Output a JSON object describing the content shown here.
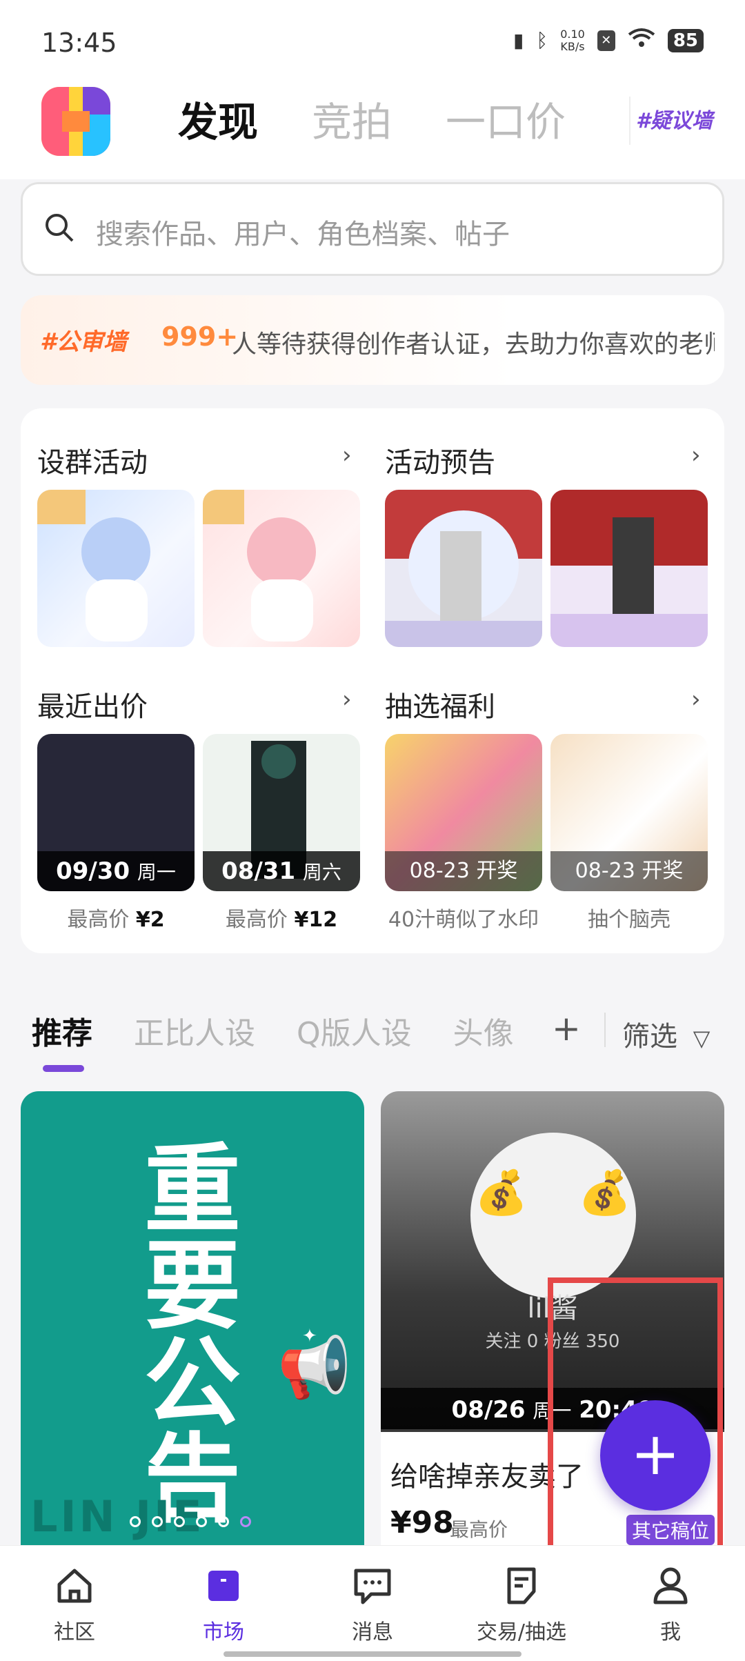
{
  "status": {
    "time": "13:45",
    "net_speed_top": "0.10",
    "net_speed_unit": "KB/s",
    "battery": "85"
  },
  "header": {
    "tabs": [
      {
        "label": "发现"
      },
      {
        "label": "竞拍"
      },
      {
        "label": "一口价"
      }
    ],
    "wall_label": "#疑议墙"
  },
  "search": {
    "placeholder": "搜索作品、用户、角色档案、帖子"
  },
  "banner": {
    "tag": "#公审墙",
    "count": "999+",
    "text": "人等待获得创作者认证，去助力你喜欢的老师"
  },
  "sections": {
    "group_activity": {
      "title": "设群活动"
    },
    "preview": {
      "title": "活动预告"
    },
    "recent_bid": {
      "title": "最近出价",
      "items": [
        {
          "date": "09/30",
          "weekday": "周一",
          "caption_prefix": "最高价",
          "price": "¥2"
        },
        {
          "date": "08/31",
          "weekday": "周六",
          "caption_prefix": "最高价",
          "price": "¥12"
        }
      ]
    },
    "lottery": {
      "title": "抽选福利",
      "items": [
        {
          "date": "08-23 开奖",
          "caption": "40汁萌似了水印"
        },
        {
          "date": "08-23 开奖",
          "caption": "抽个脑壳"
        }
      ]
    }
  },
  "categories": {
    "tabs": [
      "推荐",
      "正比人设",
      "Q版人设",
      "头像"
    ],
    "filter": "筛选"
  },
  "feed": {
    "left": {
      "notice_chars": [
        "重",
        "要",
        "公",
        "告"
      ],
      "watermark": "LIN JIE"
    },
    "right": {
      "name": "lil酱",
      "stats": "关注 0   粉丝 350",
      "date": "08/26",
      "weekday": "周一",
      "time": "20:40",
      "title": "给啥掉亲友卖了",
      "price": "¥98",
      "price_label": "最高价",
      "tag": "其它稿位"
    }
  },
  "bottom_nav": [
    {
      "label": "社区",
      "icon": "home-icon"
    },
    {
      "label": "市场",
      "icon": "market-bag-icon"
    },
    {
      "label": "消息",
      "icon": "chat-icon"
    },
    {
      "label": "交易/抽选",
      "icon": "trade-doc-icon"
    },
    {
      "label": "我",
      "icon": "person-icon"
    }
  ],
  "colors": {
    "accent": "#5b2ee0",
    "notice_bg": "#129c8c",
    "highlight_box": "#e54848"
  }
}
